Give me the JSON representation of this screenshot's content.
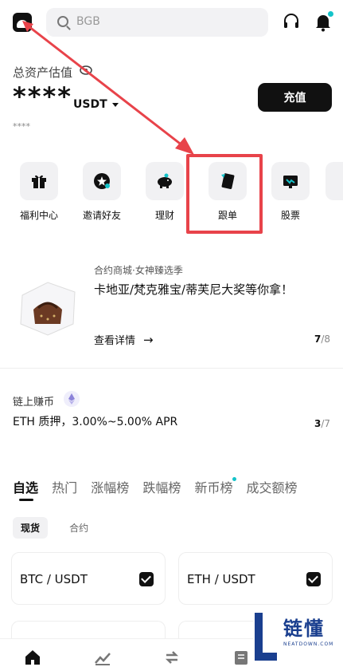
{
  "header": {
    "search_placeholder": "BGB"
  },
  "asset": {
    "label": "总资产估值",
    "value": "****",
    "unit": "USDT",
    "sub_value": "****",
    "deposit_label": "充值"
  },
  "quick_actions": [
    {
      "label": "福利中心",
      "icon": "gift-icon"
    },
    {
      "label": "邀请好友",
      "icon": "invite-icon"
    },
    {
      "label": "理财",
      "icon": "piggy-bank-icon"
    },
    {
      "label": "跟单",
      "icon": "copy-trade-icon"
    },
    {
      "label": "股票",
      "icon": "stock-icon"
    }
  ],
  "promo": {
    "tag": "合约商城·女神臻选季",
    "title": "卡地亚/梵克雅宝/蒂芙尼大奖等你拿！",
    "link": "查看详情",
    "page_current": "7",
    "page_total": "/8"
  },
  "earn": {
    "tag": "链上赚币",
    "title": "ETH 质押，3.00%~5.00% APR",
    "page_current": "3",
    "page_total": "/7"
  },
  "market_tabs": [
    "自选",
    "热门",
    "涨幅榜",
    "跌幅榜",
    "新币榜",
    "成交额榜"
  ],
  "sub_tabs": [
    "现货",
    "合约"
  ],
  "pairs": [
    "BTC / USDT",
    "ETH / USDT"
  ],
  "watermark": {
    "text": "链懂",
    "sub": "NEATDOWN.COM"
  },
  "colors": {
    "highlight": "#e8434a",
    "accent": "#14c3c9",
    "primary": "#111111"
  }
}
